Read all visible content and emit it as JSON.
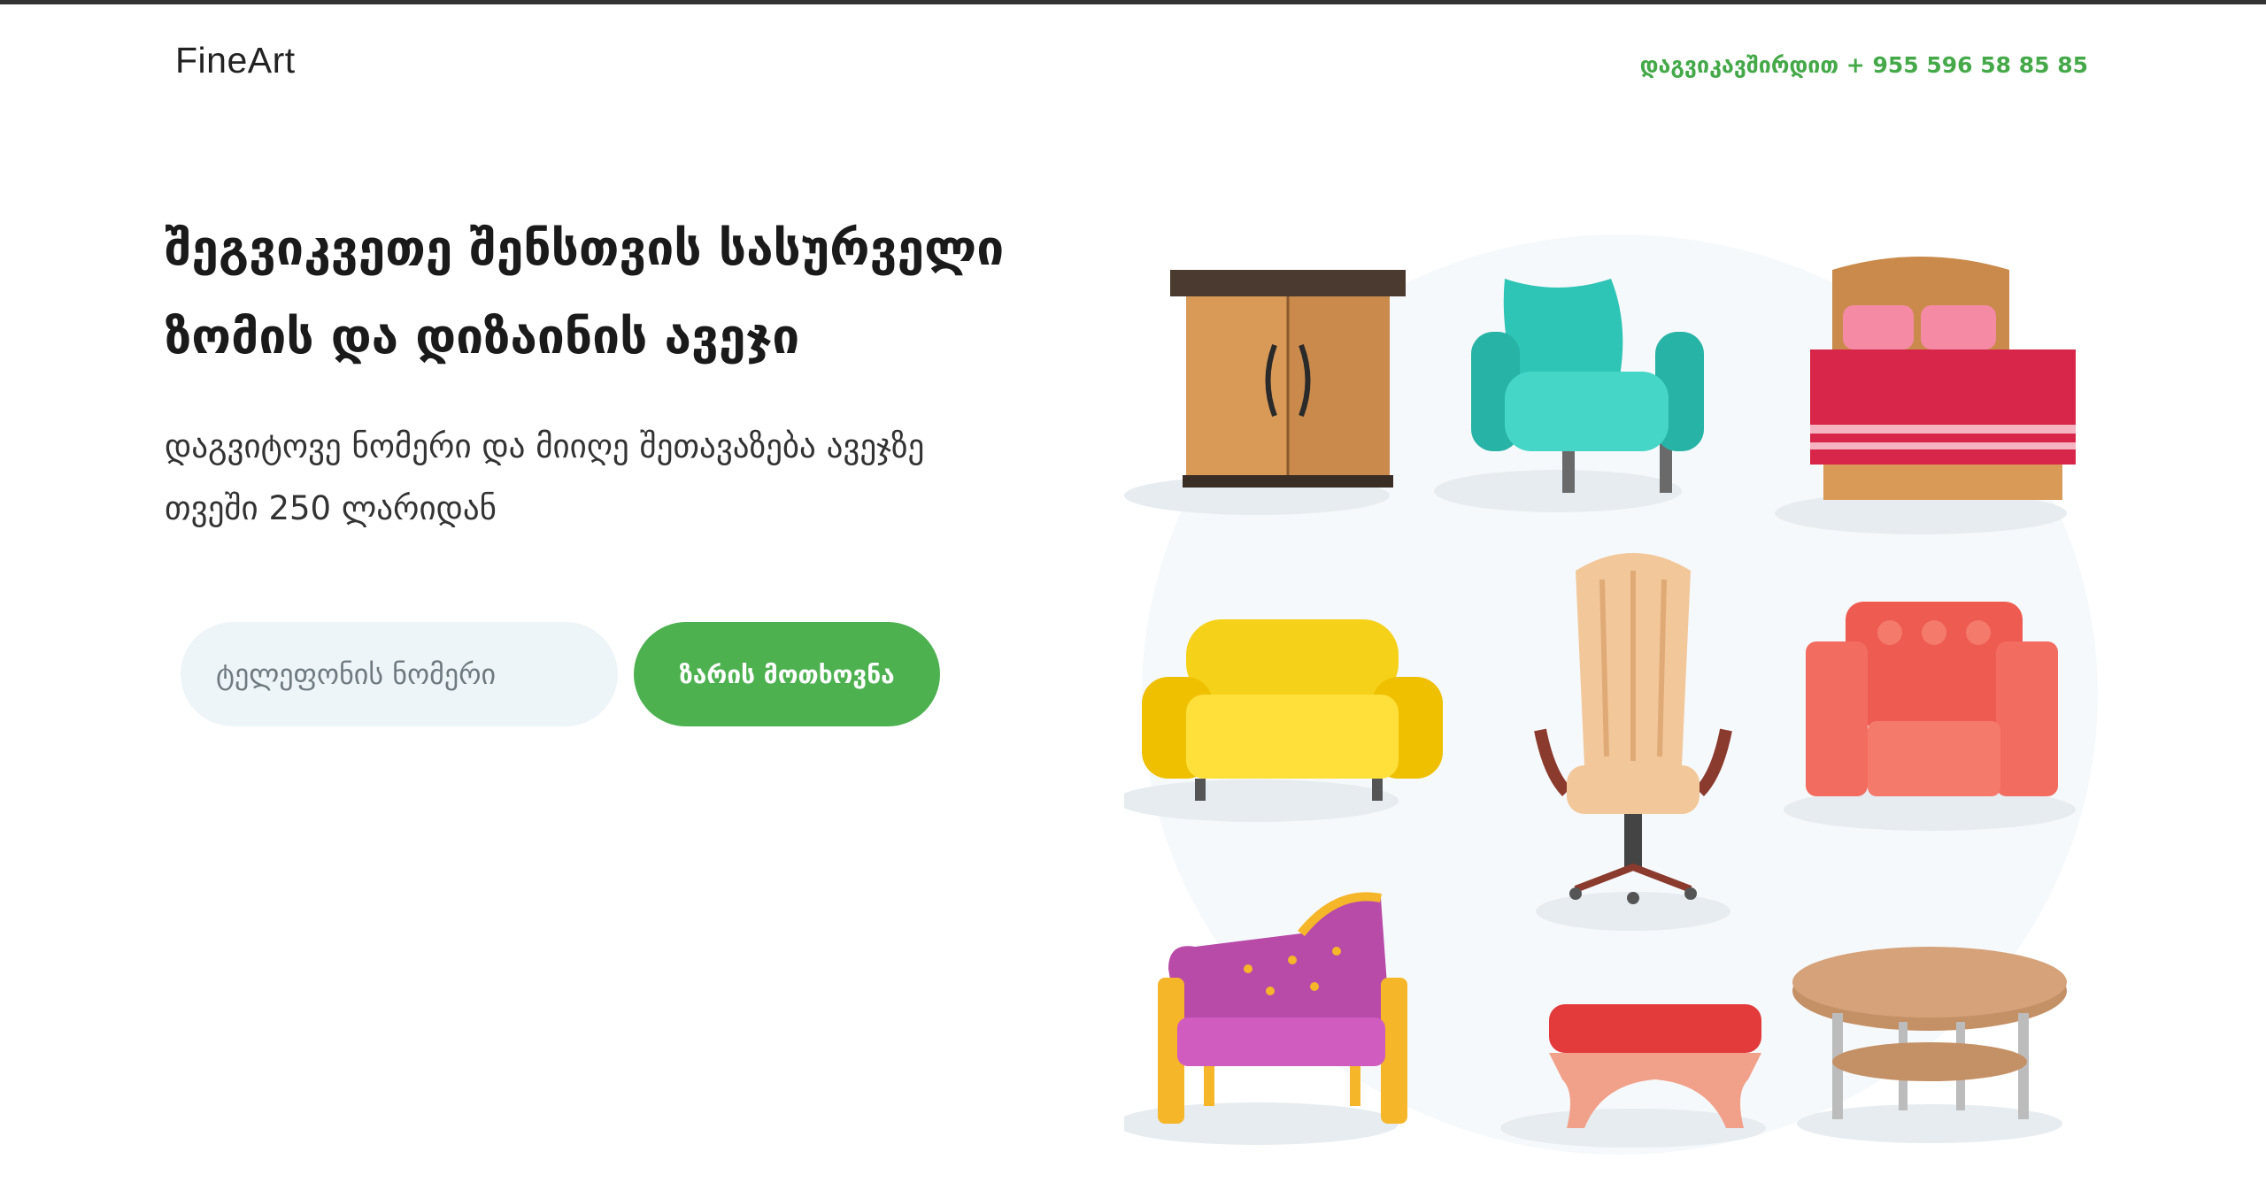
{
  "header": {
    "logo": "FineArt",
    "contact": "დაგვიკავშირდით + 955 596 58 85 85"
  },
  "hero": {
    "headline_line1": "შეგვიკვეთე შენსთვის სასურველი",
    "headline_line2": "ზომის და დიზაინის ავეჯი",
    "subtext_line1": "დაგვიტოვე ნომერი და მიიღე შეთავაზება ავეჯზე",
    "subtext_line2": "თვეში 250 ლარიდან"
  },
  "form": {
    "phone_placeholder": "ტელეფონის ნომერი",
    "submit_label": "ზარის მოთხოვნა"
  },
  "illustration": {
    "items": [
      "cabinet-icon",
      "armchair-icon",
      "bed-icon",
      "sofa-icon",
      "office-chair-icon",
      "armchair-icon",
      "chaise-icon",
      "bench-icon",
      "table-icon"
    ]
  },
  "colors": {
    "accent": "#4db150",
    "contact_text": "#45a94a",
    "input_bg": "#eef5f8"
  }
}
